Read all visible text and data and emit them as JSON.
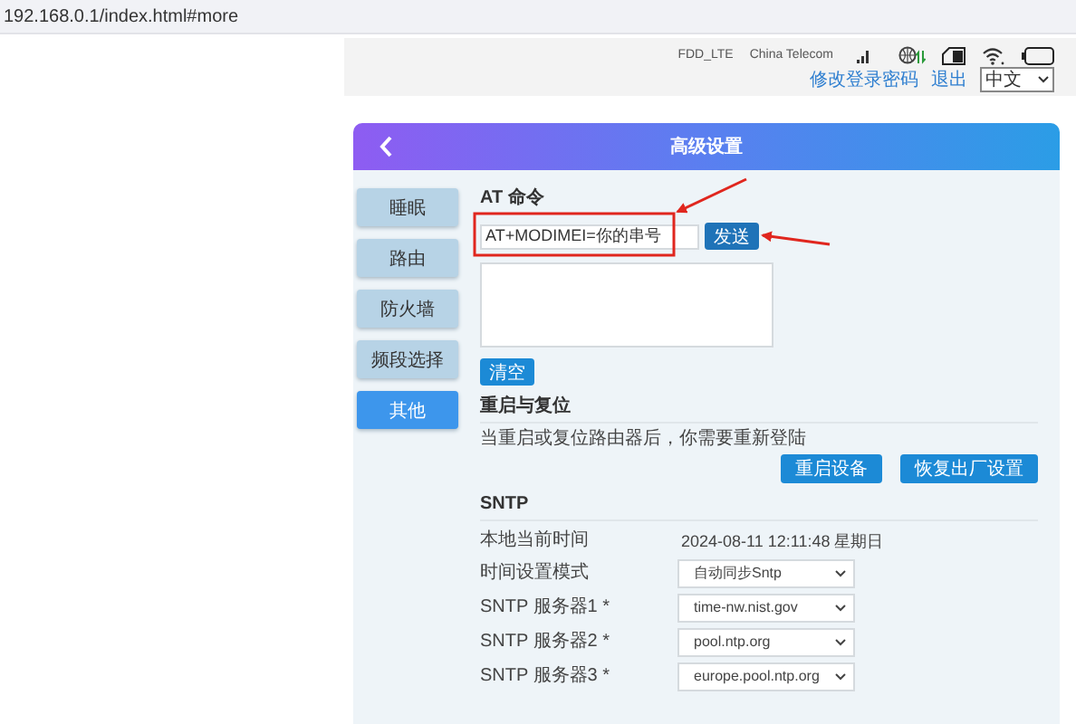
{
  "address_bar": {
    "url": "192.168.0.1/index.html#more"
  },
  "status_bar": {
    "network_type": "FDD_LTE",
    "carrier": "China Telecom",
    "links": [
      "修改登录密码",
      "退出"
    ],
    "language": "中文"
  },
  "header": {
    "title": "高级设置"
  },
  "sidebar": {
    "items": [
      {
        "label": "睡眠",
        "selected": false
      },
      {
        "label": "路由",
        "selected": false
      },
      {
        "label": "防火墙",
        "selected": false
      },
      {
        "label": "频段选择",
        "selected": false
      },
      {
        "label": "其他",
        "selected": true
      }
    ]
  },
  "at_command": {
    "title": "AT 命令",
    "input": {
      "value": "AT+MODIMEI=你的串号"
    },
    "send_button": "发送",
    "clear_button": "清空"
  },
  "reboot": {
    "title": "重启与复位",
    "note": "当重启或复位路由器后，你需要重新登陆",
    "buttons": [
      "重启设备",
      "恢复出厂设置"
    ]
  },
  "sntp": {
    "title": "SNTP",
    "rows": [
      {
        "kind": "text",
        "label": "本地当前时间",
        "value": "2024-08-11 12:11:48  星期日"
      },
      {
        "kind": "select",
        "label": "时间设置模式",
        "value": "自动同步Sntp"
      },
      {
        "kind": "select",
        "label": "SNTP 服务器1 *",
        "value": "time-nw.nist.gov"
      },
      {
        "kind": "select",
        "label": "SNTP 服务器2 *",
        "value": "pool.ntp.org"
      },
      {
        "kind": "select",
        "label": "SNTP 服务器3 *",
        "value": "europe.pool.ntp.org"
      }
    ]
  }
}
